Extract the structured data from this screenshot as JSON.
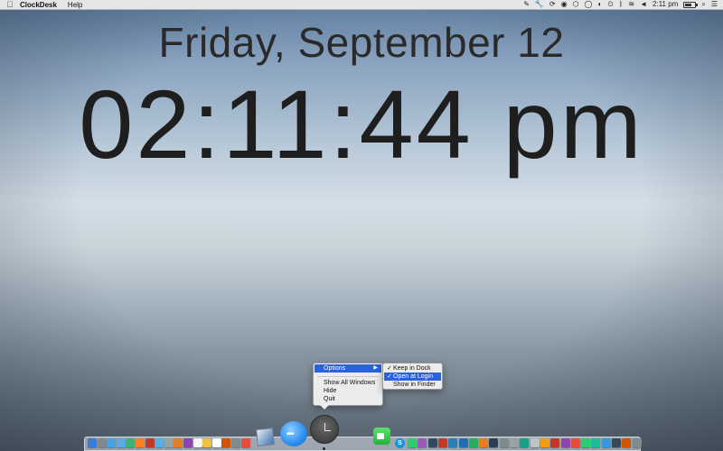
{
  "menubar": {
    "apple_icon": "apple-icon",
    "app_name": "ClockDesk",
    "menus": [
      "Help"
    ],
    "status_icons": [
      "pencil-icon",
      "wrench-icon",
      "sync-icon",
      "gamepad-icon",
      "shield-icon",
      "menu-circle-icon",
      "volume-icon",
      "clock-restore-icon",
      "bluetooth-icon",
      "wifi-icon"
    ],
    "time": "2:11 pm",
    "battery_level": 0.7
  },
  "clock": {
    "date": "Friday, September 12",
    "time": "02:11:44 pm"
  },
  "context_menu": {
    "items": [
      {
        "label": "Options",
        "has_submenu": true,
        "selected": true
      },
      {
        "label": "Show All Windows"
      },
      {
        "label": "Hide"
      },
      {
        "label": "Quit"
      }
    ],
    "submenu": [
      {
        "label": "Keep in Dock",
        "checked": true,
        "selected": false
      },
      {
        "label": "Open at Login",
        "checked": true,
        "selected": true
      },
      {
        "label": "Show in Finder",
        "checked": false,
        "selected": false
      }
    ]
  },
  "dock": {
    "big_icons": [
      "preview-icon",
      "messages-icon",
      "clockdesk-icon",
      "facetime-icon"
    ],
    "small_icon_colors": [
      "#3a7bd5",
      "#888888",
      "#4aa3df",
      "#5fa8e8",
      "#3cb371",
      "#ff7f27",
      "#c0392b",
      "#5dade2",
      "#95a5a6",
      "#e67e22",
      "#8e44ad",
      "#f5f5f5",
      "#f0c040",
      "#ffffff",
      "#d35400",
      "#7f8c8d",
      "#e74c3c",
      "#2ecc71",
      "#9b59b6",
      "#34495e",
      "#c0392b",
      "#2980b9",
      "#1f6fb2",
      "#27ae60",
      "#e67e22",
      "#2c3e50",
      "#7f8c8d",
      "#95a5a6",
      "#16a085",
      "#bdc3c7",
      "#f39c12",
      "#c0392b",
      "#8e44ad",
      "#e74c3c",
      "#2ecc71",
      "#1abc9c",
      "#3498db",
      "#34495e",
      "#d35400",
      "#7f8c8d",
      "#95a5a6",
      "#2c3e50",
      "#27ae60",
      "#5dade2",
      "#bdc3c7",
      "#e0e0e0"
    ],
    "separator_icon": "trash-icon"
  },
  "colors": {
    "menu_highlight": "#2962d9",
    "clock_text": "#1e1e1e"
  }
}
